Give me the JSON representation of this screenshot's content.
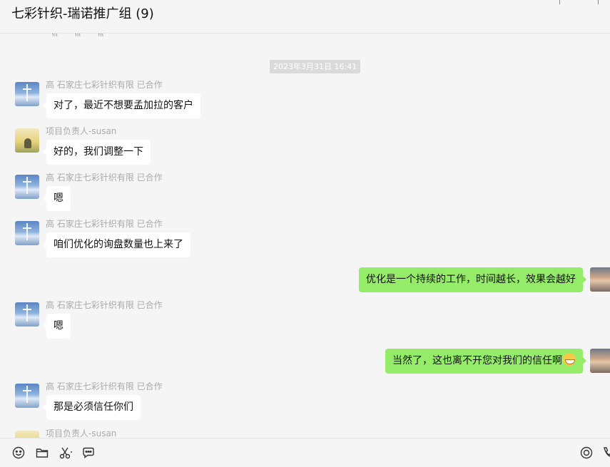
{
  "header": {
    "title": "七彩针织-瑞诺推广组 (9)"
  },
  "emoji_row": [
    "ଳ",
    "ଳ",
    "ଳ"
  ],
  "timestamp": "2023年3月31日 16:41",
  "messages": [
    {
      "sender": "高 石家庄七彩针织有限 已合作",
      "text": "对了，最近不想要孟加拉的客户",
      "avatar": "sky-cross-avatar"
    },
    {
      "sender": "项目负责人-susan",
      "text": "好的，我们调整一下",
      "avatar": "field-avatar"
    },
    {
      "sender": "高 石家庄七彩针织有限 已合作",
      "text": "嗯",
      "avatar": "sky-cross-avatar"
    },
    {
      "sender": "高 石家庄七彩针织有限 已合作",
      "text": "咱们优化的询盘数量也上来了",
      "avatar": "sky-cross-avatar"
    },
    {
      "sender": "",
      "text": "优化是一个持续的工作，时间越长，效果会越好",
      "avatar": "sunset-avatar"
    },
    {
      "sender": "高 石家庄七彩针织有限 已合作",
      "text": "嗯",
      "avatar": "sky-cross-avatar"
    },
    {
      "sender": "",
      "text": "当然了，这也离不开您对我们的信任啊",
      "avatar": "sunset-avatar",
      "emoji": "grin-emoji"
    },
    {
      "sender": "高 石家庄七彩针织有限 已合作",
      "text": "那是必须信任你们",
      "avatar": "sky-cross-avatar"
    },
    {
      "sender": "项目负责人-susan",
      "text": "",
      "avatar": "field-avatar"
    }
  ],
  "toolbar": {
    "icons": [
      "emoji-icon",
      "folder-icon",
      "scissors-icon",
      "chat-bubble-icon",
      "live-icon",
      "phone-icon"
    ]
  },
  "colors": {
    "outgoing_bubble": "#95ec69",
    "incoming_bubble": "#ffffff",
    "background": "#f5f5f5"
  }
}
